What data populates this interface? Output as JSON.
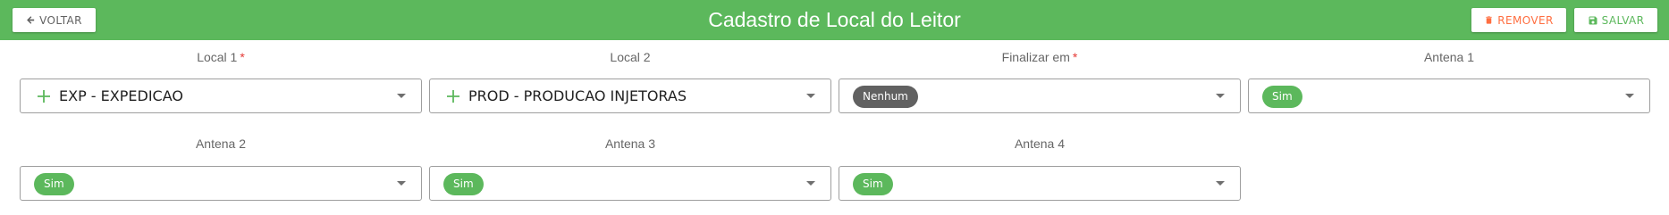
{
  "header": {
    "title": "Cadastro de Local do Leitor",
    "back_label": "VOLTAR",
    "remove_label": "REMOVER",
    "save_label": "SALVAR"
  },
  "colors": {
    "primary": "#5cb85c",
    "danger": "#ff6e40",
    "required": "#e53935",
    "chip_neutral": "#616161"
  },
  "fields": {
    "local1": {
      "label": "Local 1",
      "required_mark": "*",
      "value": "EXP - EXPEDICAO",
      "icon": "plus-icon"
    },
    "local2": {
      "label": "Local 2",
      "value": "PROD - PRODUCAO INJETORAS",
      "icon": "plus-icon"
    },
    "finalizar": {
      "label": "Finalizar em",
      "required_mark": "*",
      "value": "Nenhum"
    },
    "antena1": {
      "label": "Antena 1",
      "value": "Sim"
    },
    "antena2": {
      "label": "Antena 2",
      "value": "Sim"
    },
    "antena3": {
      "label": "Antena 3",
      "value": "Sim"
    },
    "antena4": {
      "label": "Antena 4",
      "value": "Sim"
    }
  }
}
